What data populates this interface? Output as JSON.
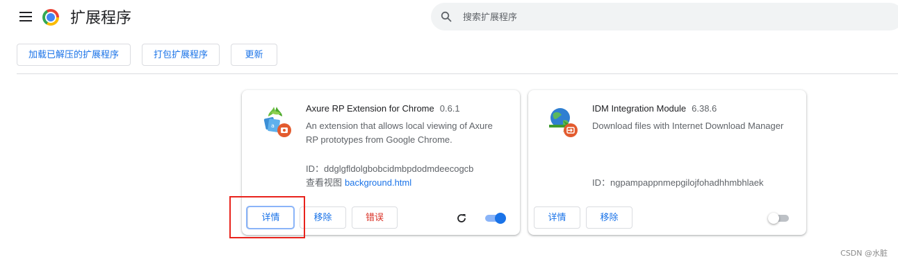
{
  "header": {
    "title": "扩展程序",
    "search_placeholder": "搜索扩展程序"
  },
  "toolbar": {
    "load_unpacked": "加载已解压的扩展程序",
    "pack_extension": "打包扩展程序",
    "update": "更新"
  },
  "extensions": [
    {
      "name": "Axure RP Extension for Chrome",
      "version": "0.6.1",
      "description": "An extension that allows local viewing of Axure RP prototypes from Google Chrome.",
      "id_label": "ID：",
      "id": "ddglgfldolgbobcidmbpdodmdeecogcb",
      "views_label": "查看视图",
      "views_link": "background.html",
      "details_label": "详情",
      "remove_label": "移除",
      "errors_label": "错误",
      "enabled": true
    },
    {
      "name": "IDM Integration Module",
      "version": "6.38.6",
      "description": "Download files with Internet Download Manager",
      "id_label": "ID：",
      "id": "ngpampappnmepgilojfohadhhmbhlaek",
      "details_label": "详情",
      "remove_label": "移除",
      "enabled": false
    }
  ],
  "colors": {
    "accent": "#1a73e8",
    "error": "#d93025",
    "highlight_box": "#e8221b"
  },
  "watermark": "CSDN @水脏"
}
